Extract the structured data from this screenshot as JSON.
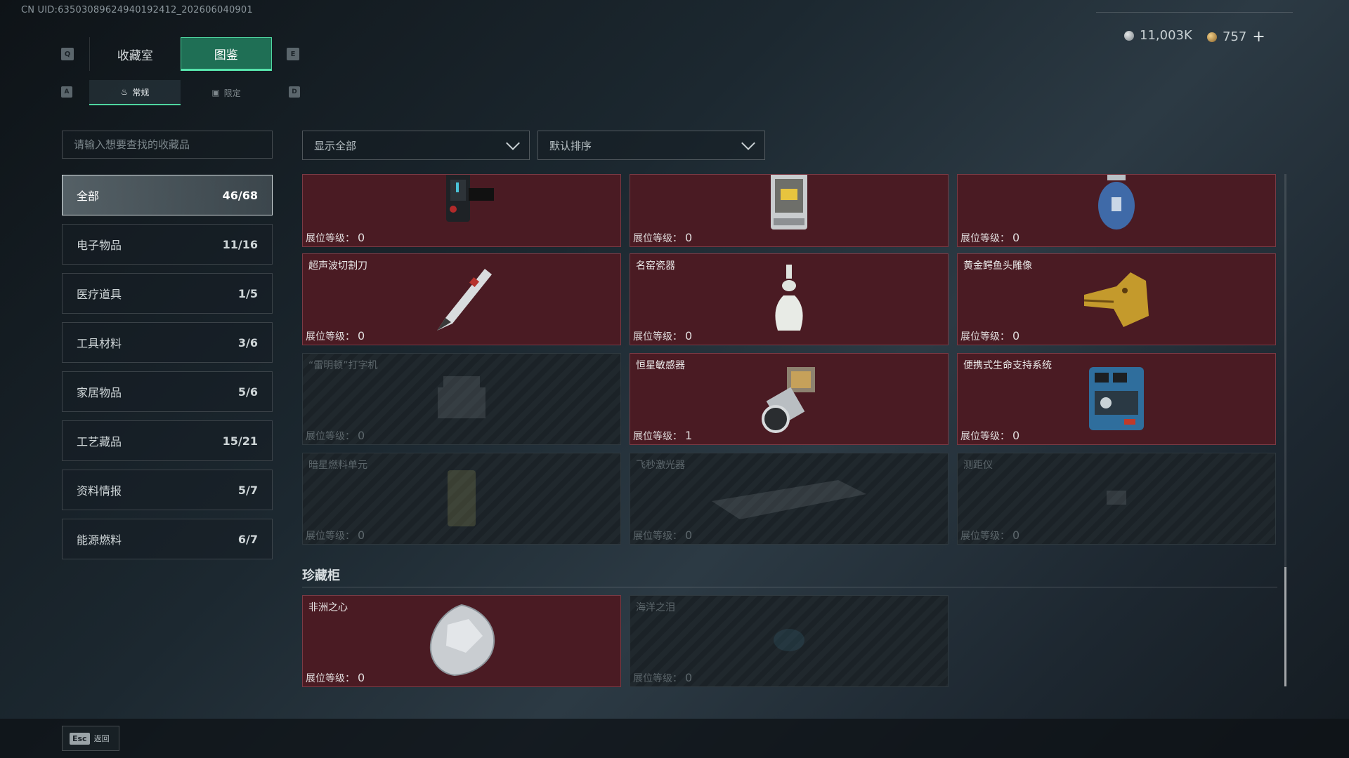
{
  "uid_text": "CN UID:6350308962494019241​2_202606040901",
  "top_tabs": [
    {
      "label": "收藏室",
      "active": false
    },
    {
      "label": "图鉴",
      "active": true
    }
  ],
  "key_hints": {
    "prev_tab": "Q",
    "next_tab": "E",
    "prev_sub": "A",
    "next_sub": "D"
  },
  "sub_tabs": [
    {
      "icon": "flame-icon",
      "label": "常规",
      "active": true
    },
    {
      "icon": "limited-icon",
      "label": "限定",
      "active": false
    }
  ],
  "currency": {
    "silver": "11,003K",
    "gold": "757",
    "add": "+"
  },
  "search": {
    "placeholder": "请输入想要查找的收藏品",
    "value": ""
  },
  "filters": {
    "show": "显示全部",
    "sort": "默认排序"
  },
  "categories": [
    {
      "label": "全部",
      "count": "46/68",
      "active": true
    },
    {
      "label": "电子物品",
      "count": "11/16",
      "active": false
    },
    {
      "label": "医疗道具",
      "count": "1/5",
      "active": false
    },
    {
      "label": "工具材料",
      "count": "3/6",
      "active": false
    },
    {
      "label": "家居物品",
      "count": "5/6",
      "active": false
    },
    {
      "label": "工艺藏品",
      "count": "15/21",
      "active": false
    },
    {
      "label": "资料情报",
      "count": "5/7",
      "active": false
    },
    {
      "label": "能源燃料",
      "count": "6/7",
      "active": false
    }
  ],
  "level_label": "展位等级：",
  "items": [
    {
      "name": "",
      "level": "0",
      "owned": true,
      "icon": "smartwatch-icon"
    },
    {
      "name": "",
      "level": "0",
      "owned": true,
      "icon": "lantern-icon"
    },
    {
      "name": "",
      "level": "0",
      "owned": true,
      "icon": "gas-canister-icon"
    },
    {
      "name": "超声波切割刀",
      "level": "0",
      "owned": true,
      "icon": "cutter-knife-icon"
    },
    {
      "name": "名窑瓷器",
      "level": "0",
      "owned": true,
      "icon": "porcelain-vase-icon"
    },
    {
      "name": "黄金鳄鱼头雕像",
      "level": "0",
      "owned": true,
      "icon": "gold-crocodile-icon"
    },
    {
      "name": "“雷明顿”打字机",
      "level": "0",
      "owned": false,
      "icon": "typewriter-icon"
    },
    {
      "name": "恒星敏感器",
      "level": "1",
      "owned": true,
      "icon": "star-sensor-icon"
    },
    {
      "name": "便携式生命支持系统",
      "level": "0",
      "owned": true,
      "icon": "life-support-icon"
    },
    {
      "name": "暗星燃料单元",
      "level": "0",
      "owned": false,
      "icon": "fuel-cell-icon"
    },
    {
      "name": "飞秒激光器",
      "level": "0",
      "owned": false,
      "icon": "laser-icon"
    },
    {
      "name": "测距仪",
      "level": "0",
      "owned": false,
      "icon": "rangefinder-icon"
    }
  ],
  "treasure_section": {
    "title": "珍藏柜",
    "items": [
      {
        "name": "非洲之心",
        "level": "0",
        "owned": true,
        "icon": "diamond-icon"
      },
      {
        "name": "海洋之泪",
        "level": "0",
        "owned": false,
        "icon": "sapphire-icon"
      }
    ]
  },
  "footer": {
    "key": "Esc",
    "label": "返回"
  }
}
